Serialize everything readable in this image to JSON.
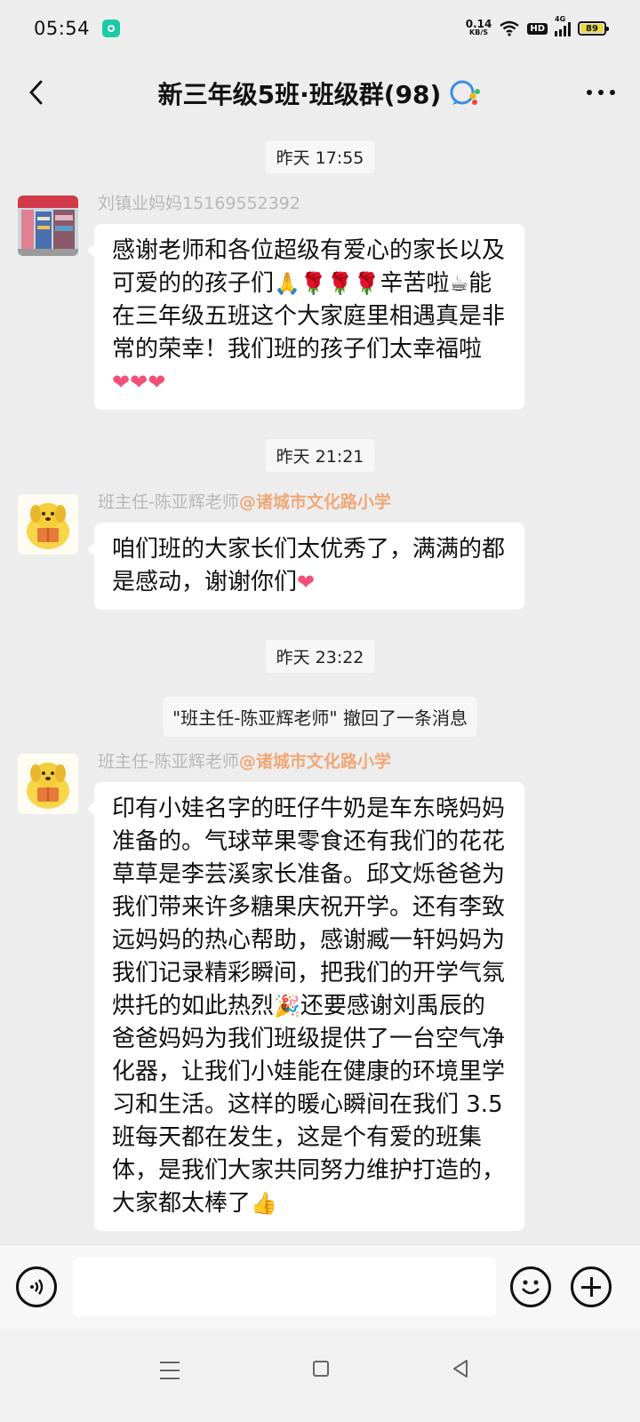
{
  "status_bar": {
    "time": "05:54",
    "net_speed_value": "0.14",
    "net_speed_unit": "KB/S",
    "hd_label": "HD",
    "network_label": "4G",
    "battery_level": "89",
    "app_icon": "chat-bubble-icon"
  },
  "header": {
    "title": "新三年级5班·班级群(98)",
    "back_icon": "chevron-left-icon",
    "more_icon": "more-dots-icon",
    "group_icon": "group-badge-icon"
  },
  "chat": {
    "timestamps": [
      "昨天 17:55",
      "昨天 21:21",
      "昨天 23:22"
    ],
    "messages": [
      {
        "sender_name": "刘镇业妈妈15169552392",
        "sender_org": "",
        "segments": [
          "感谢老师和各位超级有爱心的家长以及可爱的的孩子们",
          "🙏🌹🌹🌹",
          "辛苦啦",
          "☕",
          "能在三年级五班这个大家庭里相遇真是非常的荣幸！我们班的孩子们太幸福啦",
          "❤❤❤"
        ]
      },
      {
        "sender_name": "班主任-陈亚辉老师",
        "sender_org": "@诸城市文化路小学",
        "segments": [
          "咱们班的大家长们太优秀了，满满的都是感动，谢谢你们",
          "❤"
        ]
      },
      {
        "sender_name": "班主任-陈亚辉老师",
        "sender_org": "@诸城市文化路小学",
        "segments": [
          "印有小娃名字的旺仔牛奶是车东晓妈妈准备的。气球苹果零食还有我们的花花草草是李芸溪家长准备。邱文烁爸爸为我们带来许多糖果庆祝开学。还有李致远妈妈的热心帮助，感谢臧一轩妈妈为我们记录精彩瞬间，把我们的开学气氛烘托的如此热烈",
          "🎉",
          "还要感谢刘禹辰的爸爸妈妈为我们班级提供了一台空气净化器，让我们小娃能在健康的环境里学习和生活。这样的暖心瞬间在我们 3.5 班每天都在发生，这是个有爱的班集体，是我们大家共同努力维护打造的，大家都太棒了",
          "👍"
        ]
      }
    ],
    "recall_notice": "\"班主任-陈亚辉老师\" 撤回了一条消息"
  },
  "input_bar": {
    "voice_icon": "voice-icon",
    "emoji_icon": "emoji-icon",
    "add_icon": "plus-icon",
    "input_value": ""
  },
  "nav_bar": {
    "menu_icon": "menu-icon",
    "home_icon": "home-square-icon",
    "back_icon": "back-triangle-icon"
  },
  "colors": {
    "background": "#ededed",
    "bubble": "#ffffff",
    "sender_org": "#f0a877",
    "sender_name": "#b8b8b8",
    "heart": "#f2507a"
  }
}
